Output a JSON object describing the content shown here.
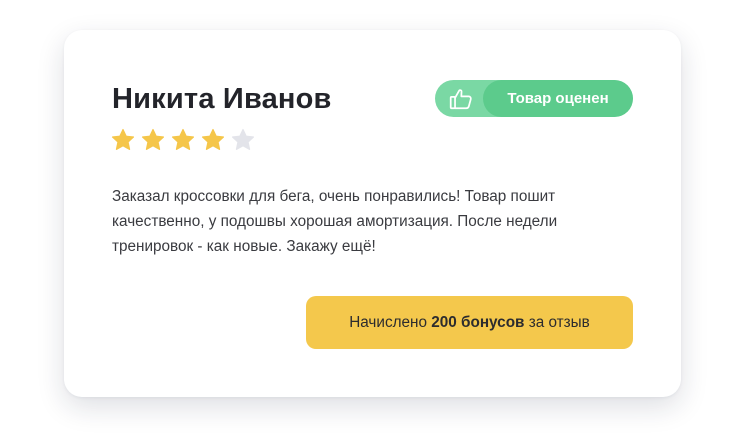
{
  "review": {
    "author": "Никита Иванов",
    "rating": 4,
    "max_rating": 5,
    "star_icon": "star-icon",
    "text": "Заказал кроссовки для бега, очень понравились! Товар пошит качественно, у подошвы хорошая амортизация. После недели тренировок - как новые. Закажу ещё!"
  },
  "badge": {
    "icon": "thumbs-up-icon",
    "label": "Товар оценен"
  },
  "bonus": {
    "prefix": "Начислено",
    "amount": "200 бонусов",
    "suffix": "за отзыв"
  },
  "colors": {
    "star_filled": "#f5c64a",
    "star_empty": "#e3e4ea",
    "badge_green": "#5ccb8c",
    "badge_green_light": "#7ad8a4",
    "bonus_yellow": "#f4c84c"
  }
}
